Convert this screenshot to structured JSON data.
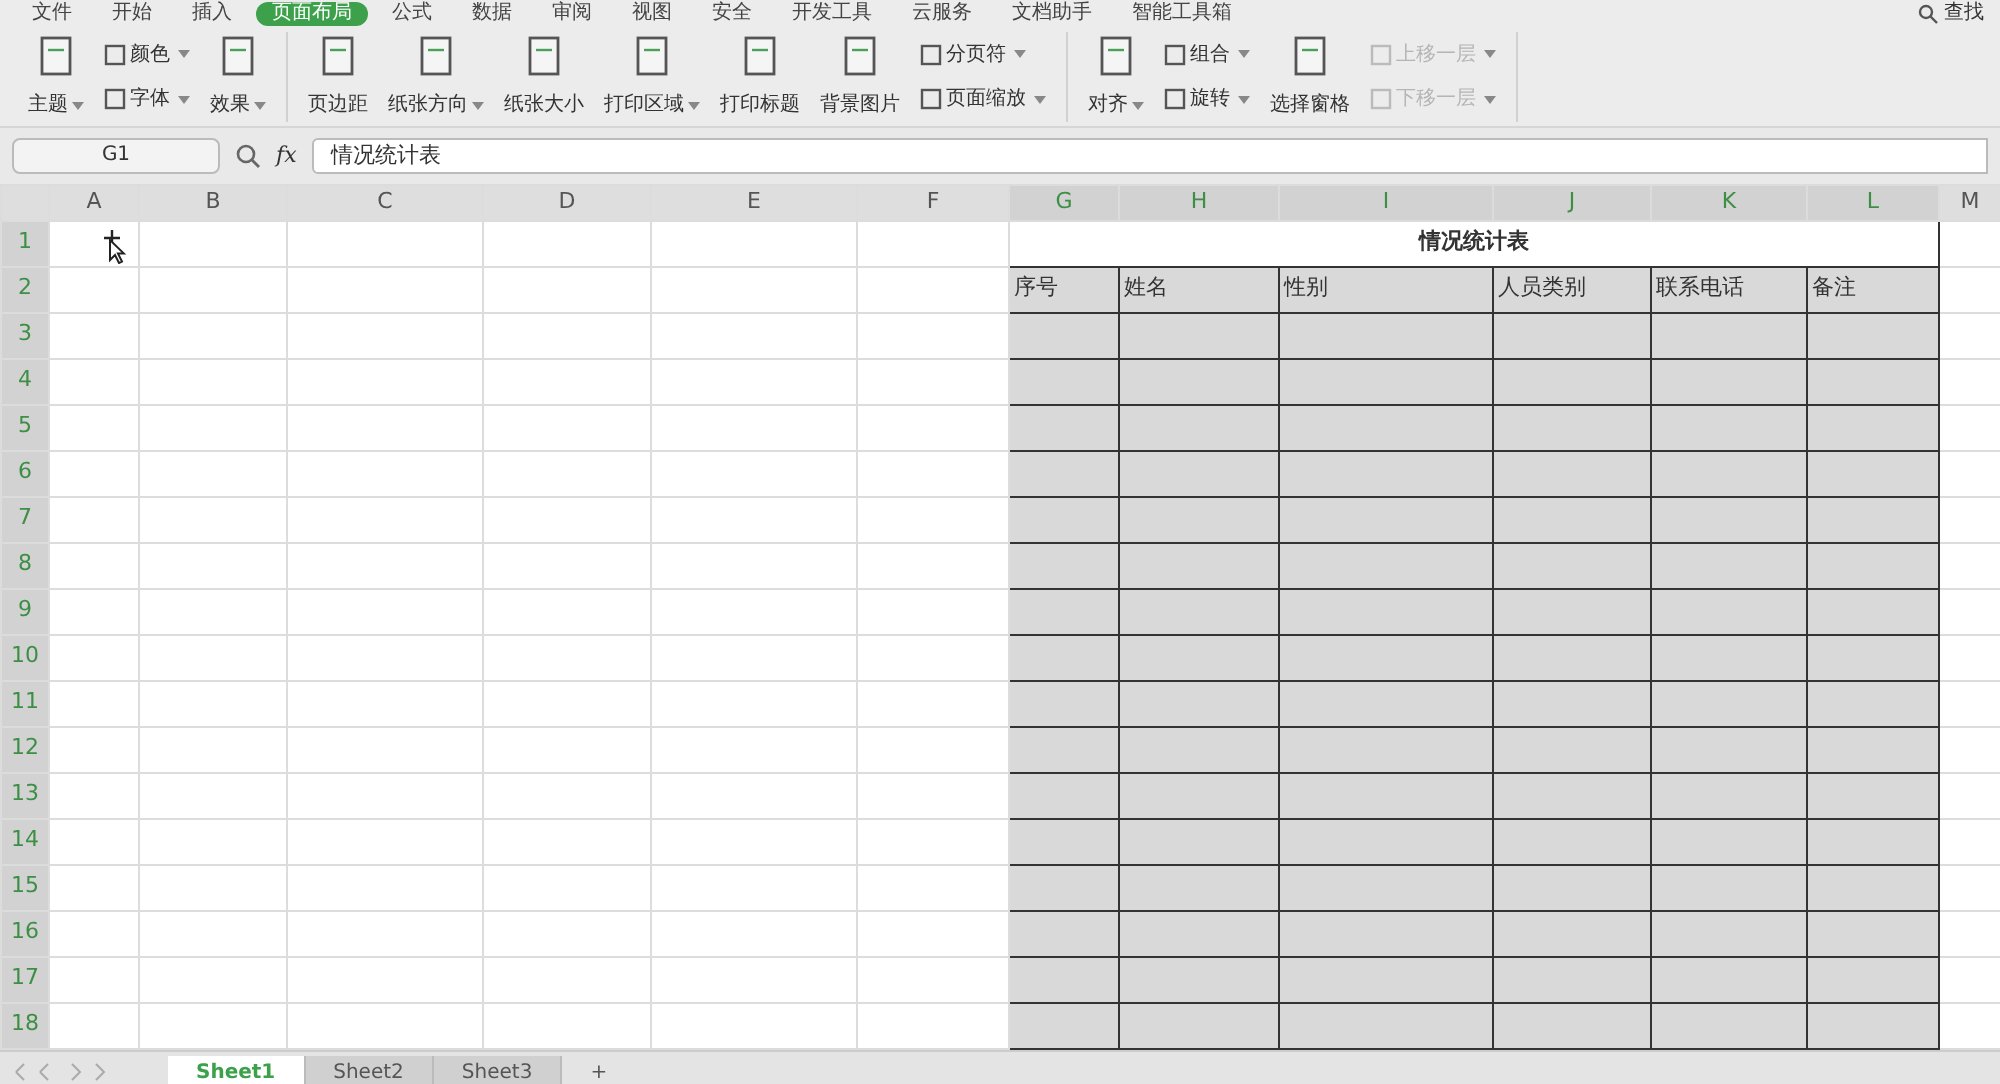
{
  "menu_tabs": [
    {
      "label": "文件",
      "selected": false
    },
    {
      "label": "开始",
      "selected": false
    },
    {
      "label": "插入",
      "selected": false
    },
    {
      "label": "页面布局",
      "selected": true
    },
    {
      "label": "公式",
      "selected": false
    },
    {
      "label": "数据",
      "selected": false
    },
    {
      "label": "审阅",
      "selected": false
    },
    {
      "label": "视图",
      "selected": false
    },
    {
      "label": "安全",
      "selected": false
    },
    {
      "label": "开发工具",
      "selected": false
    },
    {
      "label": "云服务",
      "selected": false
    },
    {
      "label": "文档助手",
      "selected": false
    },
    {
      "label": "智能工具箱",
      "selected": false
    }
  ],
  "search_label": "查找",
  "ribbon": [
    [
      {
        "kind": "large",
        "label": "主题",
        "dropdown": true
      },
      {
        "kind": "stack",
        "items": [
          {
            "label": "颜色",
            "dropdown": true,
            "disabled": false
          },
          {
            "label": "字体",
            "dropdown": true,
            "disabled": false
          }
        ]
      },
      {
        "kind": "large",
        "label": "效果",
        "dropdown": true
      }
    ],
    [
      {
        "kind": "large",
        "label": "页边距",
        "dropdown": false
      },
      {
        "kind": "large",
        "label": "纸张方向",
        "dropdown": true
      },
      {
        "kind": "large",
        "label": "纸张大小",
        "dropdown": false
      },
      {
        "kind": "large",
        "label": "打印区域",
        "dropdown": true
      },
      {
        "kind": "large",
        "label": "打印标题",
        "dropdown": false
      },
      {
        "kind": "large",
        "label": "背景图片",
        "dropdown": false
      },
      {
        "kind": "stack",
        "items": [
          {
            "label": "分页符",
            "dropdown": true,
            "disabled": false
          },
          {
            "label": "页面缩放",
            "dropdown": true,
            "disabled": false
          }
        ]
      }
    ],
    [
      {
        "kind": "large",
        "label": "对齐",
        "dropdown": true
      },
      {
        "kind": "stack",
        "items": [
          {
            "label": "组合",
            "dropdown": true,
            "disabled": false
          },
          {
            "label": "旋转",
            "dropdown": true,
            "disabled": false
          }
        ]
      },
      {
        "kind": "large",
        "label": "选择窗格",
        "dropdown": false
      },
      {
        "kind": "stack",
        "items": [
          {
            "label": "上移一层",
            "dropdown": true,
            "disabled": true
          },
          {
            "label": "下移一层",
            "dropdown": true,
            "disabled": true
          }
        ]
      }
    ]
  ],
  "name_box": "G1",
  "fx_label": "fx",
  "formula": "情况统计表",
  "columns": [
    {
      "label": "A",
      "selected": false
    },
    {
      "label": "B",
      "selected": false
    },
    {
      "label": "C",
      "selected": false
    },
    {
      "label": "D",
      "selected": false
    },
    {
      "label": "E",
      "selected": false
    },
    {
      "label": "F",
      "selected": false
    },
    {
      "label": "G",
      "selected": true
    },
    {
      "label": "H",
      "selected": true
    },
    {
      "label": "I",
      "selected": true
    },
    {
      "label": "J",
      "selected": true
    },
    {
      "label": "K",
      "selected": true
    },
    {
      "label": "L",
      "selected": true
    },
    {
      "label": "M",
      "selected": false
    }
  ],
  "rows": [
    {
      "label": "1",
      "selected": true
    },
    {
      "label": "2",
      "selected": true
    },
    {
      "label": "3",
      "selected": true
    },
    {
      "label": "4",
      "selected": true
    },
    {
      "label": "5",
      "selected": true
    },
    {
      "label": "6",
      "selected": true
    },
    {
      "label": "7",
      "selected": true
    },
    {
      "label": "8",
      "selected": true
    },
    {
      "label": "9",
      "selected": true
    },
    {
      "label": "10",
      "selected": true
    },
    {
      "label": "11",
      "selected": true
    },
    {
      "label": "12",
      "selected": true
    },
    {
      "label": "13",
      "selected": true
    },
    {
      "label": "14",
      "selected": true
    },
    {
      "label": "15",
      "selected": true
    },
    {
      "label": "16",
      "selected": true
    },
    {
      "label": "17",
      "selected": true
    },
    {
      "label": "18",
      "selected": true
    }
  ],
  "table_title": "情况统计表",
  "table_headers": [
    "序号",
    "姓名",
    "性别",
    "人员类别",
    "联系电话",
    "备注"
  ],
  "sheet_tabs": [
    {
      "label": "Sheet1",
      "selected": true
    },
    {
      "label": "Sheet2",
      "selected": false
    },
    {
      "label": "Sheet3",
      "selected": false
    }
  ],
  "add_sheet": "+"
}
